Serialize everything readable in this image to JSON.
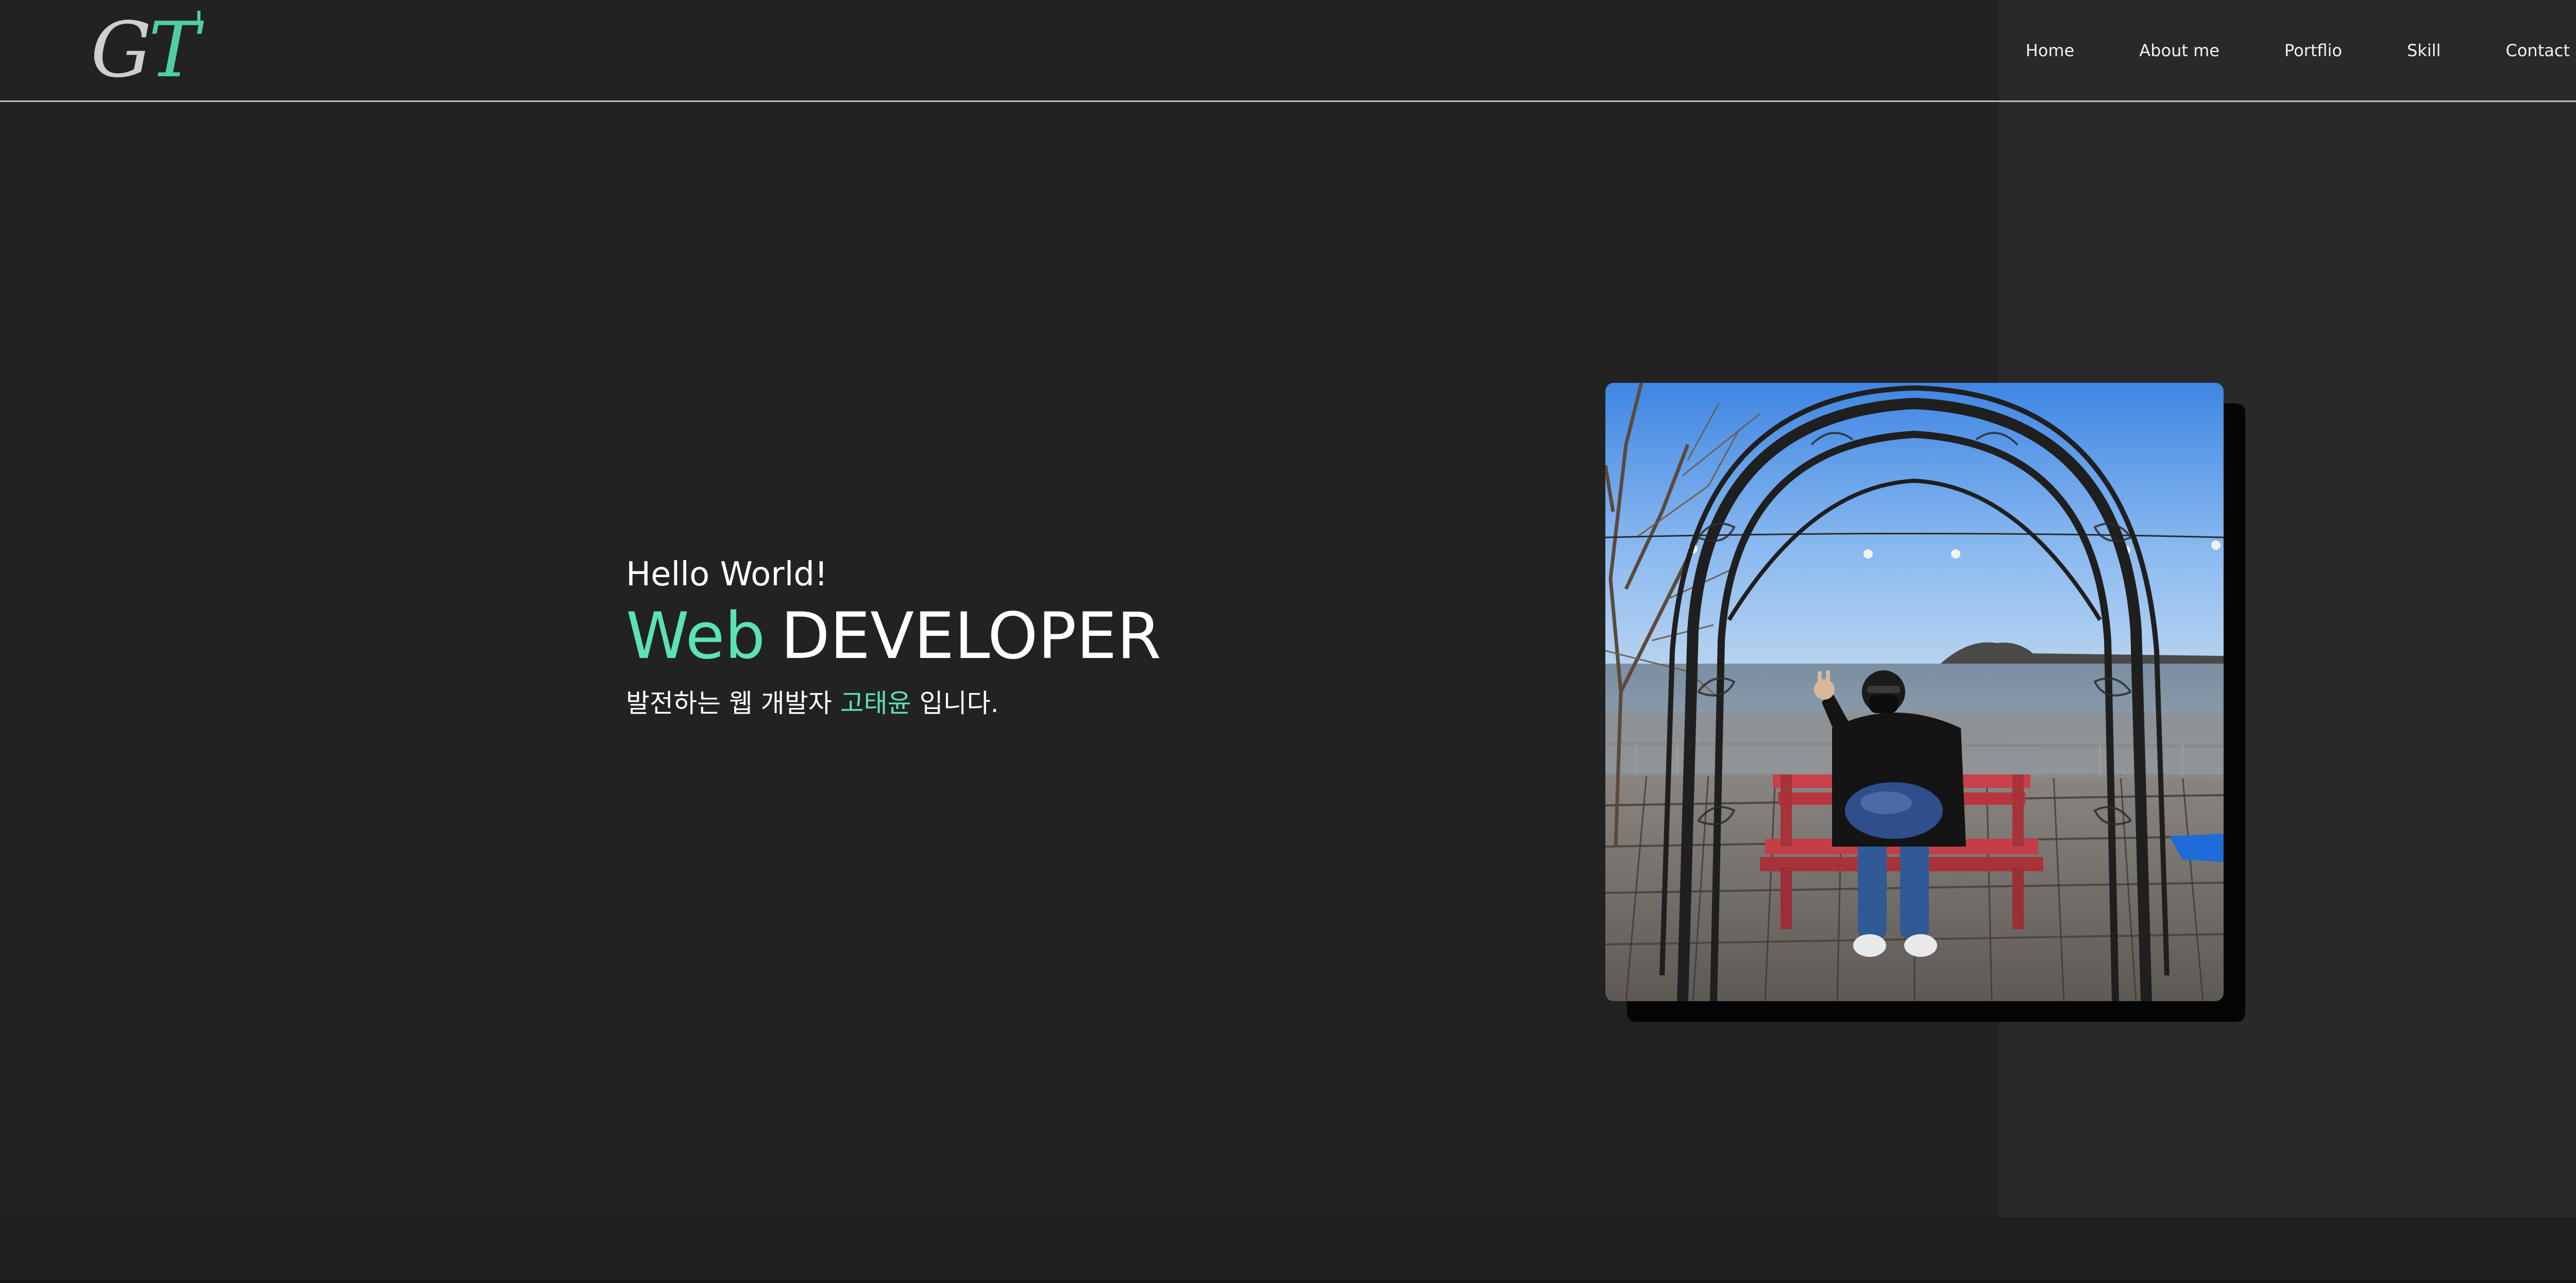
{
  "header": {
    "logo": {
      "g": "G",
      "t": "T",
      "accent": "'"
    },
    "nav": [
      {
        "label": "Home"
      },
      {
        "label": "About me"
      },
      {
        "label": "Portflio"
      },
      {
        "label": "Skill"
      },
      {
        "label": "Contact"
      }
    ]
  },
  "hero": {
    "greeting": "Hello World!",
    "title_accent": "Web",
    "title_main": "DEVELOPER",
    "subtitle_before": "발전하는 웹 개발자 ",
    "subtitle_name": "고태윤",
    "subtitle_after": " 입니다."
  },
  "colors": {
    "background": "#222222",
    "accent": "#5be3b0",
    "text": "#ffffff"
  },
  "profile_photo": {
    "icon": "profile-photo"
  }
}
